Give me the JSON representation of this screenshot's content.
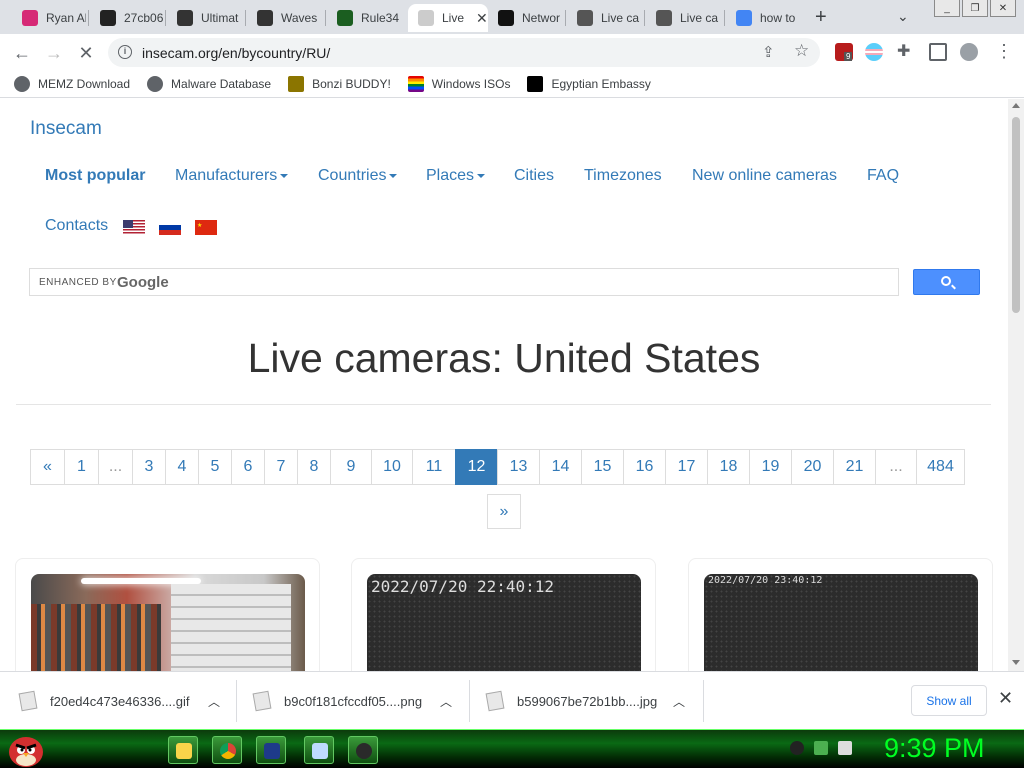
{
  "browser": {
    "tabs": [
      {
        "title": "Ryan Al",
        "favicon": "instagram-icon",
        "color": "#d62976"
      },
      {
        "title": "27cb06",
        "favicon": "b-icon",
        "color": "#222222"
      },
      {
        "title": "Ultimat",
        "favicon": "piano-icon",
        "color": "#333333"
      },
      {
        "title": "Waves",
        "favicon": "piano-icon",
        "color": "#333333"
      },
      {
        "title": "Rule34",
        "favicon": "rule34-icon",
        "color": "#1b5e20"
      },
      {
        "title": "Live",
        "favicon": "loading-icon",
        "color": "#cccccc",
        "active": true
      },
      {
        "title": "Networ",
        "favicon": "network-icon",
        "color": "#111111"
      },
      {
        "title": "Live ca",
        "favicon": "camera-icon",
        "color": "#555555"
      },
      {
        "title": "Live ca",
        "favicon": "camera-icon",
        "color": "#555555"
      },
      {
        "title": "how to",
        "favicon": "google-icon",
        "color": "#4285f4"
      }
    ],
    "url": "insecam.org/en/bycountry/RU/",
    "bookmarks": [
      {
        "label": "MEMZ Download",
        "icon": "globe-icon",
        "color": "#5f6368"
      },
      {
        "label": "Malware Database",
        "icon": "globe-icon",
        "color": "#5f6368"
      },
      {
        "label": "Bonzi BUDDY!",
        "icon": "bonzi-icon",
        "color": "#8b7500"
      },
      {
        "label": "Windows ISOs",
        "icon": "rainbow-flag-icon",
        "color": "#e40303"
      },
      {
        "label": "Egyptian Embassy",
        "icon": "wix-icon",
        "color": "#000000"
      }
    ],
    "extension_badge": "9"
  },
  "page": {
    "brand": "Insecam",
    "nav": {
      "most_popular": "Most popular",
      "manufacturers": "Manufacturers",
      "countries": "Countries",
      "places": "Places",
      "cities": "Cities",
      "timezones": "Timezones",
      "new_online": "New online cameras",
      "faq": "FAQ",
      "contacts": "Contacts"
    },
    "search": {
      "enhanced": "ENHANCED BY",
      "google": "Google"
    },
    "heading": "Live cameras: United States",
    "pagination": {
      "prev": "«",
      "pages": [
        "1",
        "...",
        "3",
        "4",
        "5",
        "6",
        "7",
        "8",
        "9",
        "10",
        "11",
        "12",
        "13",
        "14",
        "15",
        "16",
        "17",
        "18",
        "19",
        "20",
        "21",
        "...",
        "484"
      ],
      "active": "12",
      "next": "»"
    },
    "cameras": [
      {
        "timestamp": ""
      },
      {
        "timestamp": "2022/07/20 22:40:12"
      },
      {
        "timestamp": "2022/07/20 23:40:12"
      }
    ]
  },
  "downloads": {
    "items": [
      "f20ed4c473e46336....gif",
      "b9c0f181cfccdf05....png",
      "b599067be72b1bb....jpg"
    ],
    "show_all": "Show all"
  },
  "taskbar": {
    "clock": "9:39 PM"
  }
}
